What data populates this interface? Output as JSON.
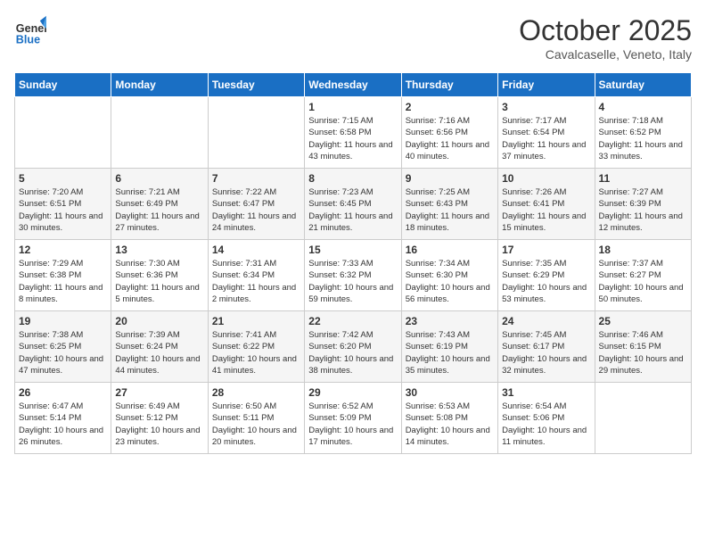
{
  "header": {
    "logo_line1": "General",
    "logo_line2": "Blue",
    "month": "October 2025",
    "location": "Cavalcaselle, Veneto, Italy"
  },
  "weekdays": [
    "Sunday",
    "Monday",
    "Tuesday",
    "Wednesday",
    "Thursday",
    "Friday",
    "Saturday"
  ],
  "weeks": [
    [
      {
        "day": "",
        "sunrise": "",
        "sunset": "",
        "daylight": ""
      },
      {
        "day": "",
        "sunrise": "",
        "sunset": "",
        "daylight": ""
      },
      {
        "day": "",
        "sunrise": "",
        "sunset": "",
        "daylight": ""
      },
      {
        "day": "1",
        "sunrise": "Sunrise: 7:15 AM",
        "sunset": "Sunset: 6:58 PM",
        "daylight": "Daylight: 11 hours and 43 minutes."
      },
      {
        "day": "2",
        "sunrise": "Sunrise: 7:16 AM",
        "sunset": "Sunset: 6:56 PM",
        "daylight": "Daylight: 11 hours and 40 minutes."
      },
      {
        "day": "3",
        "sunrise": "Sunrise: 7:17 AM",
        "sunset": "Sunset: 6:54 PM",
        "daylight": "Daylight: 11 hours and 37 minutes."
      },
      {
        "day": "4",
        "sunrise": "Sunrise: 7:18 AM",
        "sunset": "Sunset: 6:52 PM",
        "daylight": "Daylight: 11 hours and 33 minutes."
      }
    ],
    [
      {
        "day": "5",
        "sunrise": "Sunrise: 7:20 AM",
        "sunset": "Sunset: 6:51 PM",
        "daylight": "Daylight: 11 hours and 30 minutes."
      },
      {
        "day": "6",
        "sunrise": "Sunrise: 7:21 AM",
        "sunset": "Sunset: 6:49 PM",
        "daylight": "Daylight: 11 hours and 27 minutes."
      },
      {
        "day": "7",
        "sunrise": "Sunrise: 7:22 AM",
        "sunset": "Sunset: 6:47 PM",
        "daylight": "Daylight: 11 hours and 24 minutes."
      },
      {
        "day": "8",
        "sunrise": "Sunrise: 7:23 AM",
        "sunset": "Sunset: 6:45 PM",
        "daylight": "Daylight: 11 hours and 21 minutes."
      },
      {
        "day": "9",
        "sunrise": "Sunrise: 7:25 AM",
        "sunset": "Sunset: 6:43 PM",
        "daylight": "Daylight: 11 hours and 18 minutes."
      },
      {
        "day": "10",
        "sunrise": "Sunrise: 7:26 AM",
        "sunset": "Sunset: 6:41 PM",
        "daylight": "Daylight: 11 hours and 15 minutes."
      },
      {
        "day": "11",
        "sunrise": "Sunrise: 7:27 AM",
        "sunset": "Sunset: 6:39 PM",
        "daylight": "Daylight: 11 hours and 12 minutes."
      }
    ],
    [
      {
        "day": "12",
        "sunrise": "Sunrise: 7:29 AM",
        "sunset": "Sunset: 6:38 PM",
        "daylight": "Daylight: 11 hours and 8 minutes."
      },
      {
        "day": "13",
        "sunrise": "Sunrise: 7:30 AM",
        "sunset": "Sunset: 6:36 PM",
        "daylight": "Daylight: 11 hours and 5 minutes."
      },
      {
        "day": "14",
        "sunrise": "Sunrise: 7:31 AM",
        "sunset": "Sunset: 6:34 PM",
        "daylight": "Daylight: 11 hours and 2 minutes."
      },
      {
        "day": "15",
        "sunrise": "Sunrise: 7:33 AM",
        "sunset": "Sunset: 6:32 PM",
        "daylight": "Daylight: 10 hours and 59 minutes."
      },
      {
        "day": "16",
        "sunrise": "Sunrise: 7:34 AM",
        "sunset": "Sunset: 6:30 PM",
        "daylight": "Daylight: 10 hours and 56 minutes."
      },
      {
        "day": "17",
        "sunrise": "Sunrise: 7:35 AM",
        "sunset": "Sunset: 6:29 PM",
        "daylight": "Daylight: 10 hours and 53 minutes."
      },
      {
        "day": "18",
        "sunrise": "Sunrise: 7:37 AM",
        "sunset": "Sunset: 6:27 PM",
        "daylight": "Daylight: 10 hours and 50 minutes."
      }
    ],
    [
      {
        "day": "19",
        "sunrise": "Sunrise: 7:38 AM",
        "sunset": "Sunset: 6:25 PM",
        "daylight": "Daylight: 10 hours and 47 minutes."
      },
      {
        "day": "20",
        "sunrise": "Sunrise: 7:39 AM",
        "sunset": "Sunset: 6:24 PM",
        "daylight": "Daylight: 10 hours and 44 minutes."
      },
      {
        "day": "21",
        "sunrise": "Sunrise: 7:41 AM",
        "sunset": "Sunset: 6:22 PM",
        "daylight": "Daylight: 10 hours and 41 minutes."
      },
      {
        "day": "22",
        "sunrise": "Sunrise: 7:42 AM",
        "sunset": "Sunset: 6:20 PM",
        "daylight": "Daylight: 10 hours and 38 minutes."
      },
      {
        "day": "23",
        "sunrise": "Sunrise: 7:43 AM",
        "sunset": "Sunset: 6:19 PM",
        "daylight": "Daylight: 10 hours and 35 minutes."
      },
      {
        "day": "24",
        "sunrise": "Sunrise: 7:45 AM",
        "sunset": "Sunset: 6:17 PM",
        "daylight": "Daylight: 10 hours and 32 minutes."
      },
      {
        "day": "25",
        "sunrise": "Sunrise: 7:46 AM",
        "sunset": "Sunset: 6:15 PM",
        "daylight": "Daylight: 10 hours and 29 minutes."
      }
    ],
    [
      {
        "day": "26",
        "sunrise": "Sunrise: 6:47 AM",
        "sunset": "Sunset: 5:14 PM",
        "daylight": "Daylight: 10 hours and 26 minutes."
      },
      {
        "day": "27",
        "sunrise": "Sunrise: 6:49 AM",
        "sunset": "Sunset: 5:12 PM",
        "daylight": "Daylight: 10 hours and 23 minutes."
      },
      {
        "day": "28",
        "sunrise": "Sunrise: 6:50 AM",
        "sunset": "Sunset: 5:11 PM",
        "daylight": "Daylight: 10 hours and 20 minutes."
      },
      {
        "day": "29",
        "sunrise": "Sunrise: 6:52 AM",
        "sunset": "Sunset: 5:09 PM",
        "daylight": "Daylight: 10 hours and 17 minutes."
      },
      {
        "day": "30",
        "sunrise": "Sunrise: 6:53 AM",
        "sunset": "Sunset: 5:08 PM",
        "daylight": "Daylight: 10 hours and 14 minutes."
      },
      {
        "day": "31",
        "sunrise": "Sunrise: 6:54 AM",
        "sunset": "Sunset: 5:06 PM",
        "daylight": "Daylight: 10 hours and 11 minutes."
      },
      {
        "day": "",
        "sunrise": "",
        "sunset": "",
        "daylight": ""
      }
    ]
  ]
}
